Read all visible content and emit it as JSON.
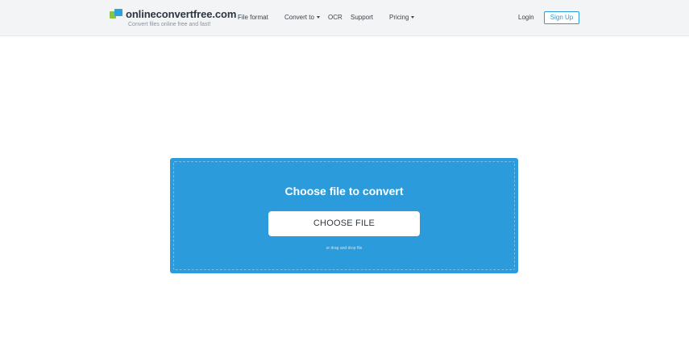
{
  "header": {
    "logo_name": "onlineconvertfree.com",
    "logo_tagline": "Convert files online free and fast!",
    "nav": {
      "file_format": "File format",
      "convert_to": "Convert to",
      "ocr": "OCR",
      "support": "Support",
      "pricing": "Pricing"
    },
    "login": "Login",
    "signup": "Sign Up"
  },
  "upload": {
    "title": "Choose file to convert",
    "button_label": "CHOOSE FILE",
    "drag_hint": "or drag and drop file"
  },
  "colors": {
    "accent": "#2b9bdb",
    "header_bg": "#f3f4f6",
    "logo_green": "#8bc34a"
  },
  "icons": {
    "logo": "logo-mark-icon",
    "dropdown": "chevron-down-icon"
  }
}
